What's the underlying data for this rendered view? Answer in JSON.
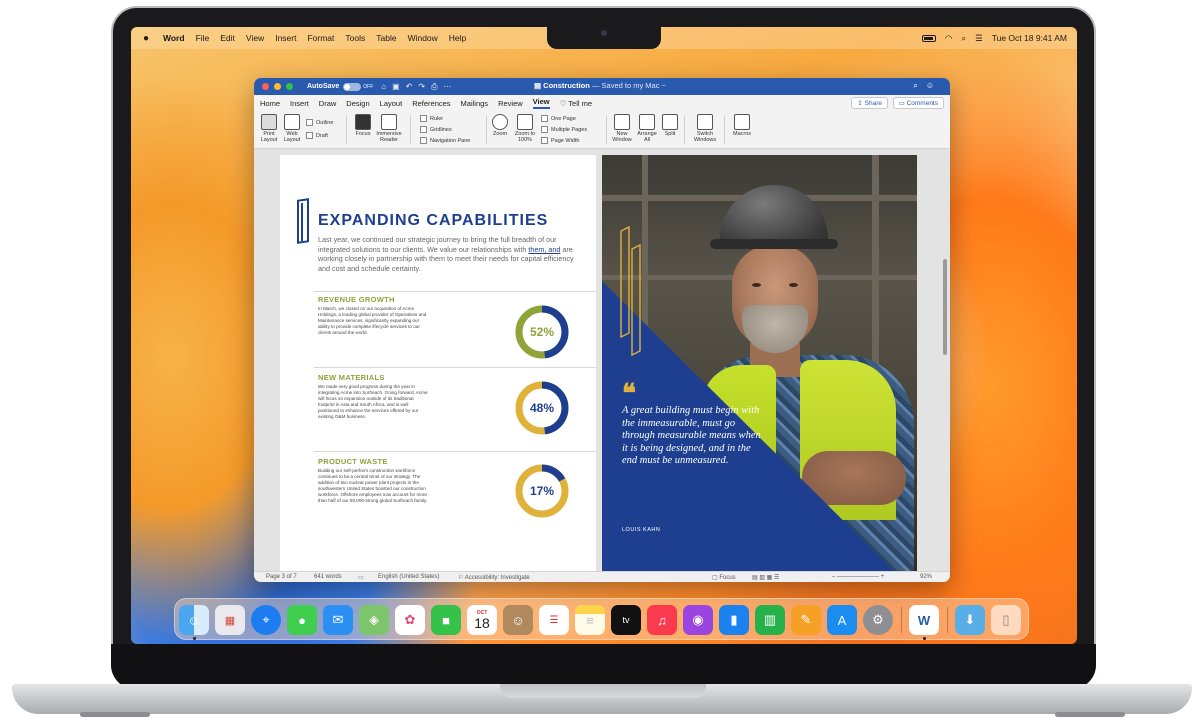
{
  "menubar": {
    "apple": "",
    "app": "Word",
    "items": [
      "File",
      "Edit",
      "View",
      "Insert",
      "Format",
      "Tools",
      "Table",
      "Window",
      "Help"
    ],
    "datetime": "Tue Oct 18  9:41 AM"
  },
  "window": {
    "autosave": "AutoSave",
    "autosave_state": "OFF",
    "doc_title": "Construction",
    "doc_status": "— Saved to my Mac ~"
  },
  "tabs": [
    "Home",
    "Insert",
    "Draw",
    "Design",
    "Layout",
    "References",
    "Mailings",
    "Review",
    "View",
    "Tell me"
  ],
  "active_tab": "View",
  "share": "Share",
  "comments": "Comments",
  "ribbon": {
    "print_layout": "Print Layout",
    "web_layout": "Web Layout",
    "outline": "Outline",
    "draft": "Draft",
    "focus": "Focus",
    "immersive_reader": "Immersive Reader",
    "ruler": "Ruler",
    "gridlines": "Gridlines",
    "navigation_pane": "Navigation Pane",
    "zoom": "Zoom",
    "zoom_100": "Zoom to 100%",
    "one_page": "One Page",
    "multiple_pages": "Multiple Pages",
    "page_width": "Page Width",
    "new_window": "New Window",
    "arrange_all": "Arrange All",
    "split": "Split",
    "switch_windows": "Switch Windows",
    "macros": "Macros"
  },
  "document": {
    "title": "EXPANDING CAPABILITIES",
    "intro_a": "Last year, we continued our strategic journey to bring the full breadth of our integrated solutions to our clients. We value our relationships with ",
    "intro_link": "them, and",
    "intro_b": " are working closely in partnership with them to meet their needs for capital efficiency and cost and schedule certainty.",
    "sections": [
      {
        "heading": "REVENUE GROWTH",
        "body": "In March, we closed on our acquisition of Acme Holdings, a leading global provider of Operations and Maintenance services, significantly expanding our ability to provide complete lifecycle services to our clients around the world.",
        "percent_label": "52%",
        "percent": 52
      },
      {
        "heading": "NEW MATERIALS",
        "body": "We made very good progress during the year in integrating Acme into Surfreach. Going forward, Acme will focus on expansion outside of its traditional footprint in Asia and South Africa, and is well positioned to enhance the services offered by our existing O&M business.",
        "percent_label": "48%",
        "percent": 48
      },
      {
        "heading": "PRODUCT WASTE",
        "body": "Building our self-perform construction workforce continues to be a central tenet of our strategy. The addition of two nuclear power plant projects in the southwestern United States boosted our construction workforce. Offshore employees now account for more than half of our 60,000-strong global Surfreach family.",
        "percent_label": "17%",
        "percent": 17
      }
    ],
    "quote": "A great building must begin with the immeasurable, must go through measurable means when it is being designed, and in the end must be unmeasured.",
    "quote_mark": "❝",
    "author": "LOUIS KAHN"
  },
  "status": {
    "page": "Page 3 of 7",
    "words": "641 words",
    "language": "English (United States)",
    "accessibility": "Accessibility: Investigate",
    "focus": "Focus",
    "zoom": "92%"
  },
  "dock": {
    "icons": [
      "finder-icon",
      "launchpad-icon",
      "safari-icon",
      "messages-icon",
      "mail-icon",
      "maps-icon",
      "photos-icon",
      "facetime-icon",
      "calendar-icon",
      "contacts-icon",
      "reminders-icon",
      "notes-icon",
      "tv-icon",
      "music-icon",
      "podcasts-icon",
      "keynote-icon",
      "numbers-icon",
      "pages-icon",
      "app-store-icon",
      "system-preferences-icon",
      "word-icon",
      "downloads-folder-icon",
      "trash-icon"
    ],
    "calendar_month": "OCT",
    "calendar_day": "18"
  },
  "colors": {
    "word_blue": "#2a5aad",
    "doc_navy": "#1e3f8f",
    "accent_green": "#8ea33a",
    "accent_gold": "#e0b23a"
  }
}
